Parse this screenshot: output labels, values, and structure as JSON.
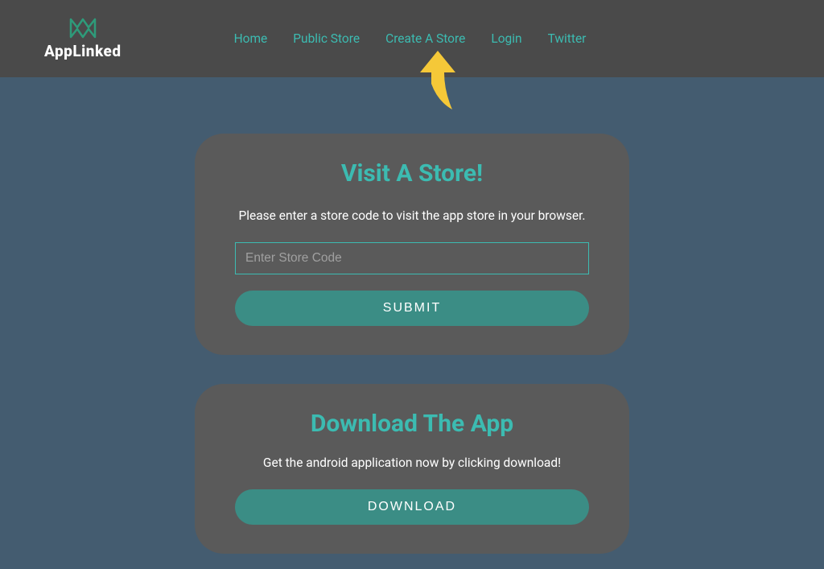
{
  "logo": {
    "text": "AppLinked"
  },
  "nav": {
    "home": "Home",
    "publicStore": "Public Store",
    "createStore": "Create A Store",
    "login": "Login",
    "twitter": "Twitter"
  },
  "visitCard": {
    "title": "Visit A Store!",
    "description": "Please enter a store code to visit the app store in your browser.",
    "placeholder": "Enter Store Code",
    "submitLabel": "SUBMIT"
  },
  "downloadCard": {
    "title": "Download The App",
    "description": "Get the android application now by clicking download!",
    "downloadLabel": "DOWNLOAD"
  }
}
